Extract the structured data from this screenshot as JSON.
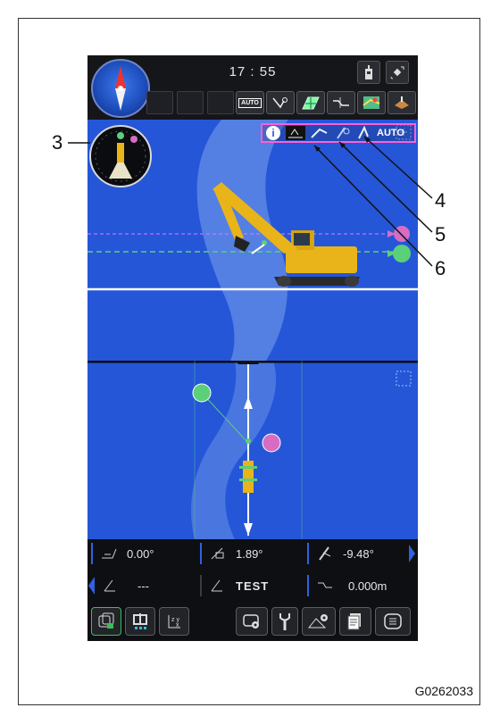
{
  "header": {
    "clock": "17 : 55",
    "auto_label": "AUTO"
  },
  "status_icons": {
    "auto_label": "AUTO",
    "info_label": "i"
  },
  "callouts": [
    "3",
    "4",
    "5",
    "6"
  ],
  "readouts_row1": {
    "angle1": "0.00°",
    "angle2": "1.89°",
    "angle3": "-9.48°"
  },
  "readouts_row2": {
    "value1": "---",
    "value2": "TEST",
    "value3": "0.000m"
  },
  "figure_id": "G0262033",
  "colors": {
    "screen_blue": "#2556d8",
    "device_dark": "#0e0f12",
    "highlight_magenta": "#ff5fd6",
    "target_green": "#5ad07a",
    "machine_yellow": "#e8b41a"
  }
}
